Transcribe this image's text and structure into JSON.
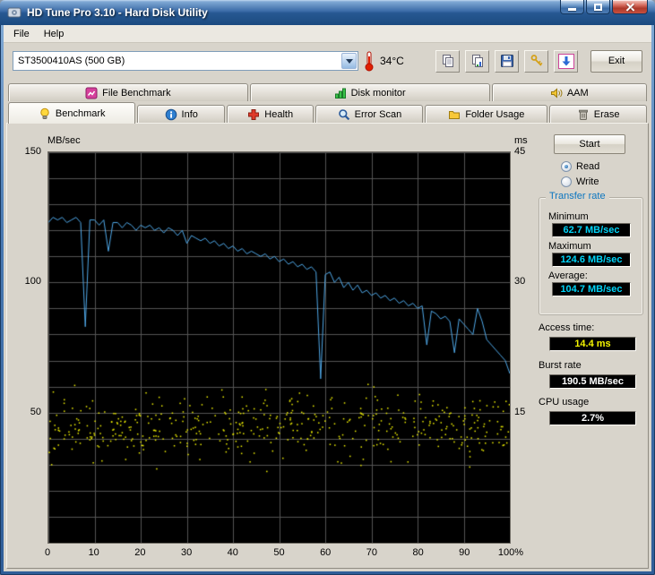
{
  "window": {
    "title": "HD Tune Pro 3.10 - Hard Disk Utility"
  },
  "menu": {
    "items": [
      "File",
      "Help"
    ]
  },
  "toolbar": {
    "drive_selected": "ST3500410AS (500 GB)",
    "temperature": "34°C",
    "exit_label": "Exit"
  },
  "tabs": {
    "top": [
      "File Benchmark",
      "Disk monitor",
      "AAM"
    ],
    "bottom": [
      "Benchmark",
      "Info",
      "Health",
      "Error Scan",
      "Folder Usage",
      "Erase"
    ],
    "active": "Benchmark"
  },
  "controls": {
    "start_label": "Start",
    "read_label": "Read",
    "write_label": "Write",
    "read_selected": true
  },
  "results": {
    "transfer_rate_group": "Transfer rate",
    "minimum_label": "Minimum",
    "minimum_value": "62.7 MB/sec",
    "maximum_label": "Maximum",
    "maximum_value": "124.6 MB/sec",
    "average_label": "Average:",
    "average_value": "104.7 MB/sec",
    "access_time_label": "Access time:",
    "access_time_value": "14.4 ms",
    "burst_rate_label": "Burst rate",
    "burst_rate_value": "190.5 MB/sec",
    "cpu_usage_label": "CPU usage",
    "cpu_usage_value": "2.7%"
  },
  "chart_data": {
    "type": "line",
    "x_axis": {
      "unit": "%",
      "min": 0,
      "max": 100,
      "ticks": [
        "0",
        "10",
        "20",
        "30",
        "40",
        "50",
        "60",
        "70",
        "80",
        "90",
        "100%"
      ]
    },
    "y_left": {
      "label": "MB/sec",
      "min": 0,
      "max": 150,
      "ticks": [
        50,
        100,
        150
      ],
      "grid_step": 10
    },
    "y_right": {
      "label": "ms",
      "min": 0,
      "max": 45,
      "ticks": [
        15,
        30,
        45
      ]
    },
    "plot_bg": "#000000",
    "grid_color": "#555555",
    "legend": "off",
    "series": [
      {
        "name": "transfer-rate",
        "type": "line",
        "axis": "left",
        "color": "#4fa8e8",
        "x_start": 0,
        "x_step": 1,
        "values": [
          123,
          125,
          124,
          125,
          123,
          124,
          125,
          123,
          83,
          124,
          124,
          122,
          124,
          112,
          123,
          123,
          121,
          123,
          122,
          120,
          122,
          121,
          122,
          120,
          121,
          119,
          121,
          120,
          118,
          120,
          115,
          118,
          117,
          116,
          117,
          115,
          116,
          114,
          115,
          113,
          114,
          112,
          113,
          111,
          112,
          111,
          110,
          111,
          109,
          110,
          108,
          109,
          107,
          108,
          106,
          107,
          105,
          106,
          104,
          63,
          103,
          104,
          100,
          102,
          98,
          100,
          97,
          99,
          96,
          97,
          95,
          96,
          94,
          95,
          93,
          94,
          92,
          93,
          91,
          92,
          90,
          91,
          76,
          89,
          88,
          86,
          87,
          85,
          73,
          86,
          84,
          82,
          80,
          90,
          85,
          78,
          76,
          74,
          72,
          70,
          65
        ]
      },
      {
        "name": "access-time",
        "type": "scatter",
        "axis": "right",
        "color": "#f0f000",
        "points": {
          "count": 480,
          "seed": 11,
          "ms_mean": 13.5,
          "ms_spread": 5.5,
          "ms_min": 3.5,
          "ms_max": 27
        }
      }
    ]
  }
}
